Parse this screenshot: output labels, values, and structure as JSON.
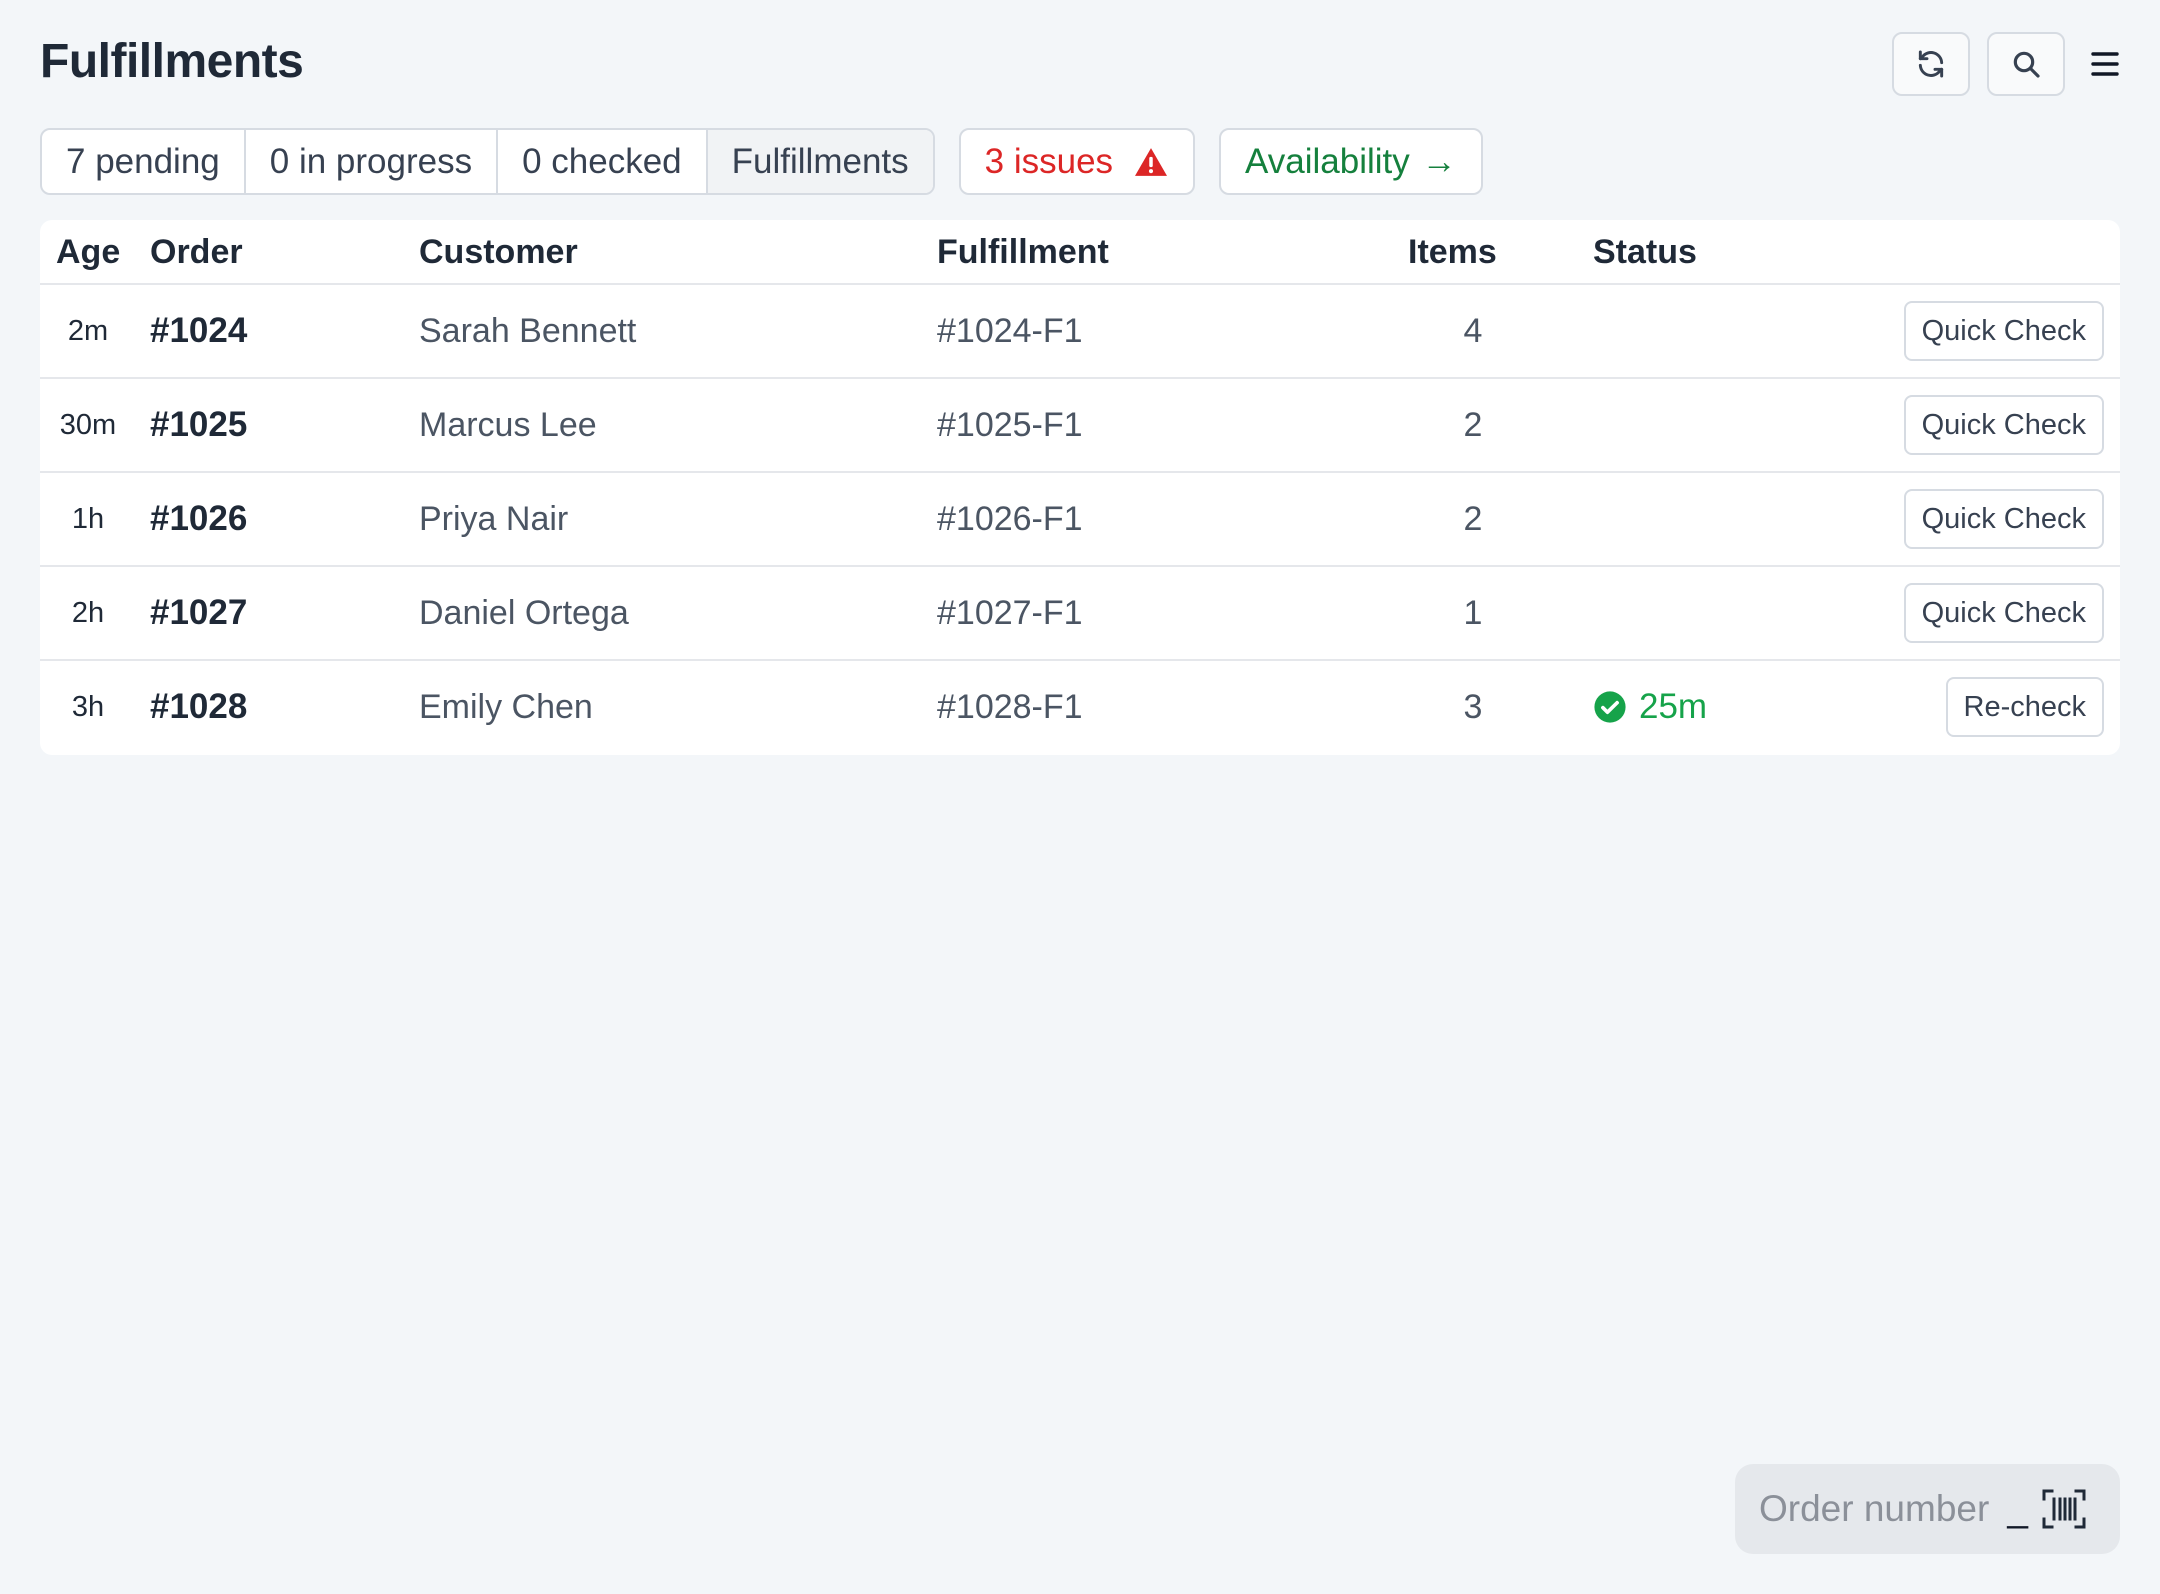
{
  "header": {
    "title": "Fulfillments",
    "actions": {
      "refresh_icon": "refresh-icon",
      "search_icon": "search-icon",
      "menu_icon": "hamburger-menu-icon"
    }
  },
  "summary": {
    "segments": [
      {
        "label": "7 pending"
      },
      {
        "label": "0 in progress"
      },
      {
        "label": "0 checked"
      },
      {
        "label": "Fulfillments",
        "active": true
      }
    ],
    "issues": {
      "label": "3 issues",
      "icon": "warning-triangle-icon",
      "color": "#dc2626"
    },
    "availability": {
      "label": "Availability",
      "arrow": "→",
      "color": "#15803d"
    }
  },
  "table": {
    "columns": [
      "Age",
      "Order",
      "Customer",
      "Fulfillment",
      "Items",
      "Status"
    ],
    "rows": [
      {
        "age": "2m",
        "order": "#1024",
        "customer": "Sarah Bennett",
        "fulfillment": "#1024-F1",
        "items": "4",
        "status": "",
        "action": "Quick Check"
      },
      {
        "age": "30m",
        "order": "#1025",
        "customer": "Marcus Lee",
        "fulfillment": "#1025-F1",
        "items": "2",
        "status": "",
        "action": "Quick Check"
      },
      {
        "age": "1h",
        "order": "#1026",
        "customer": "Priya Nair",
        "fulfillment": "#1026-F1",
        "items": "2",
        "status": "",
        "action": "Quick Check"
      },
      {
        "age": "2h",
        "order": "#1027",
        "customer": "Daniel Ortega",
        "fulfillment": "#1027-F1",
        "items": "1",
        "status": "",
        "action": "Quick Check"
      },
      {
        "age": "3h",
        "order": "#1028",
        "customer": "Emily Chen",
        "fulfillment": "#1028-F1",
        "items": "3",
        "status": "25m",
        "status_icon": "check-circle-icon",
        "action": "Re-check"
      }
    ]
  },
  "scan": {
    "placeholder": "Order number",
    "cursor": "_",
    "icon": "barcode-scan-icon"
  },
  "colors": {
    "background": "#f3f6f9",
    "success": "#16a34a",
    "danger": "#dc2626",
    "border": "#d6dbe2"
  }
}
